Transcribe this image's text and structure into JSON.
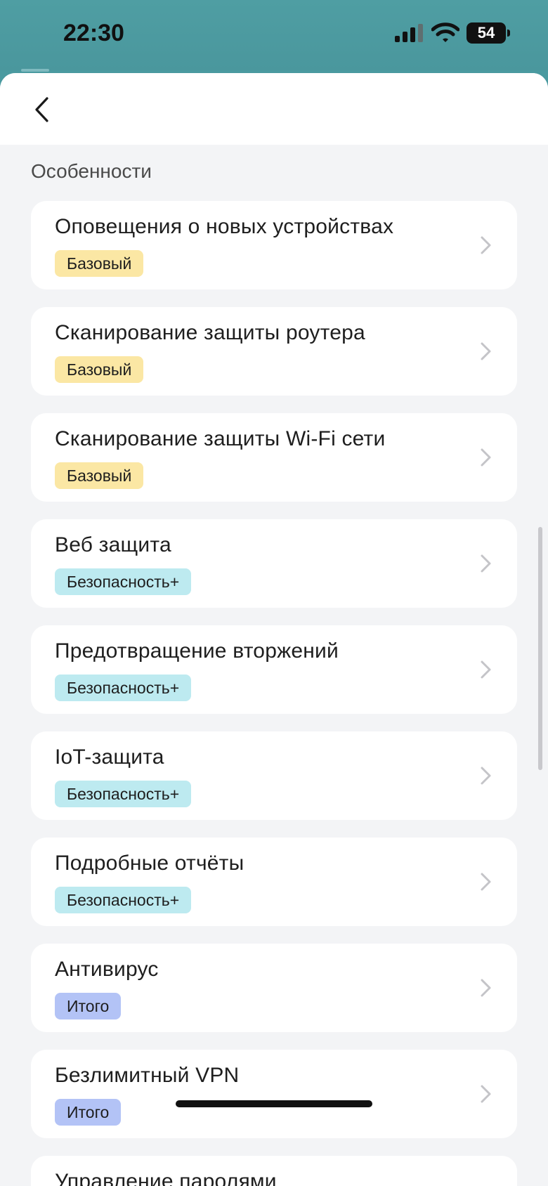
{
  "status": {
    "time": "22:30",
    "battery": "54"
  },
  "section": {
    "title": "Особенности"
  },
  "features": [
    {
      "title": "Оповещения о новых устройствах",
      "tier": "Базовый",
      "tier_color": "#fbe7a4"
    },
    {
      "title": "Сканирование защиты роутера",
      "tier": "Базовый",
      "tier_color": "#fbe7a4"
    },
    {
      "title": "Сканирование защиты Wi-Fi сети",
      "tier": "Базовый",
      "tier_color": "#fbe7a4"
    },
    {
      "title": "Веб защита",
      "tier": "Безопасность+",
      "tier_color": "#bdeaf0"
    },
    {
      "title": "Предотвращение вторжений",
      "tier": "Безопасность+",
      "tier_color": "#bdeaf0"
    },
    {
      "title": "IoT-защита",
      "tier": "Безопасность+",
      "tier_color": "#bdeaf0"
    },
    {
      "title": "Подробные отчёты",
      "tier": "Безопасность+",
      "tier_color": "#bdeaf0"
    },
    {
      "title": "Антивирус",
      "tier": "Итого",
      "tier_color": "#b3c3f6"
    },
    {
      "title": "Безлимитный VPN",
      "tier": "Итого",
      "tier_color": "#b3c3f6"
    },
    {
      "title": "Управление паролями",
      "tier": "",
      "tier_color": "#b3c3f6"
    }
  ],
  "icons": {
    "back": "chevron-left-icon",
    "row": "chevron-right-icon"
  }
}
